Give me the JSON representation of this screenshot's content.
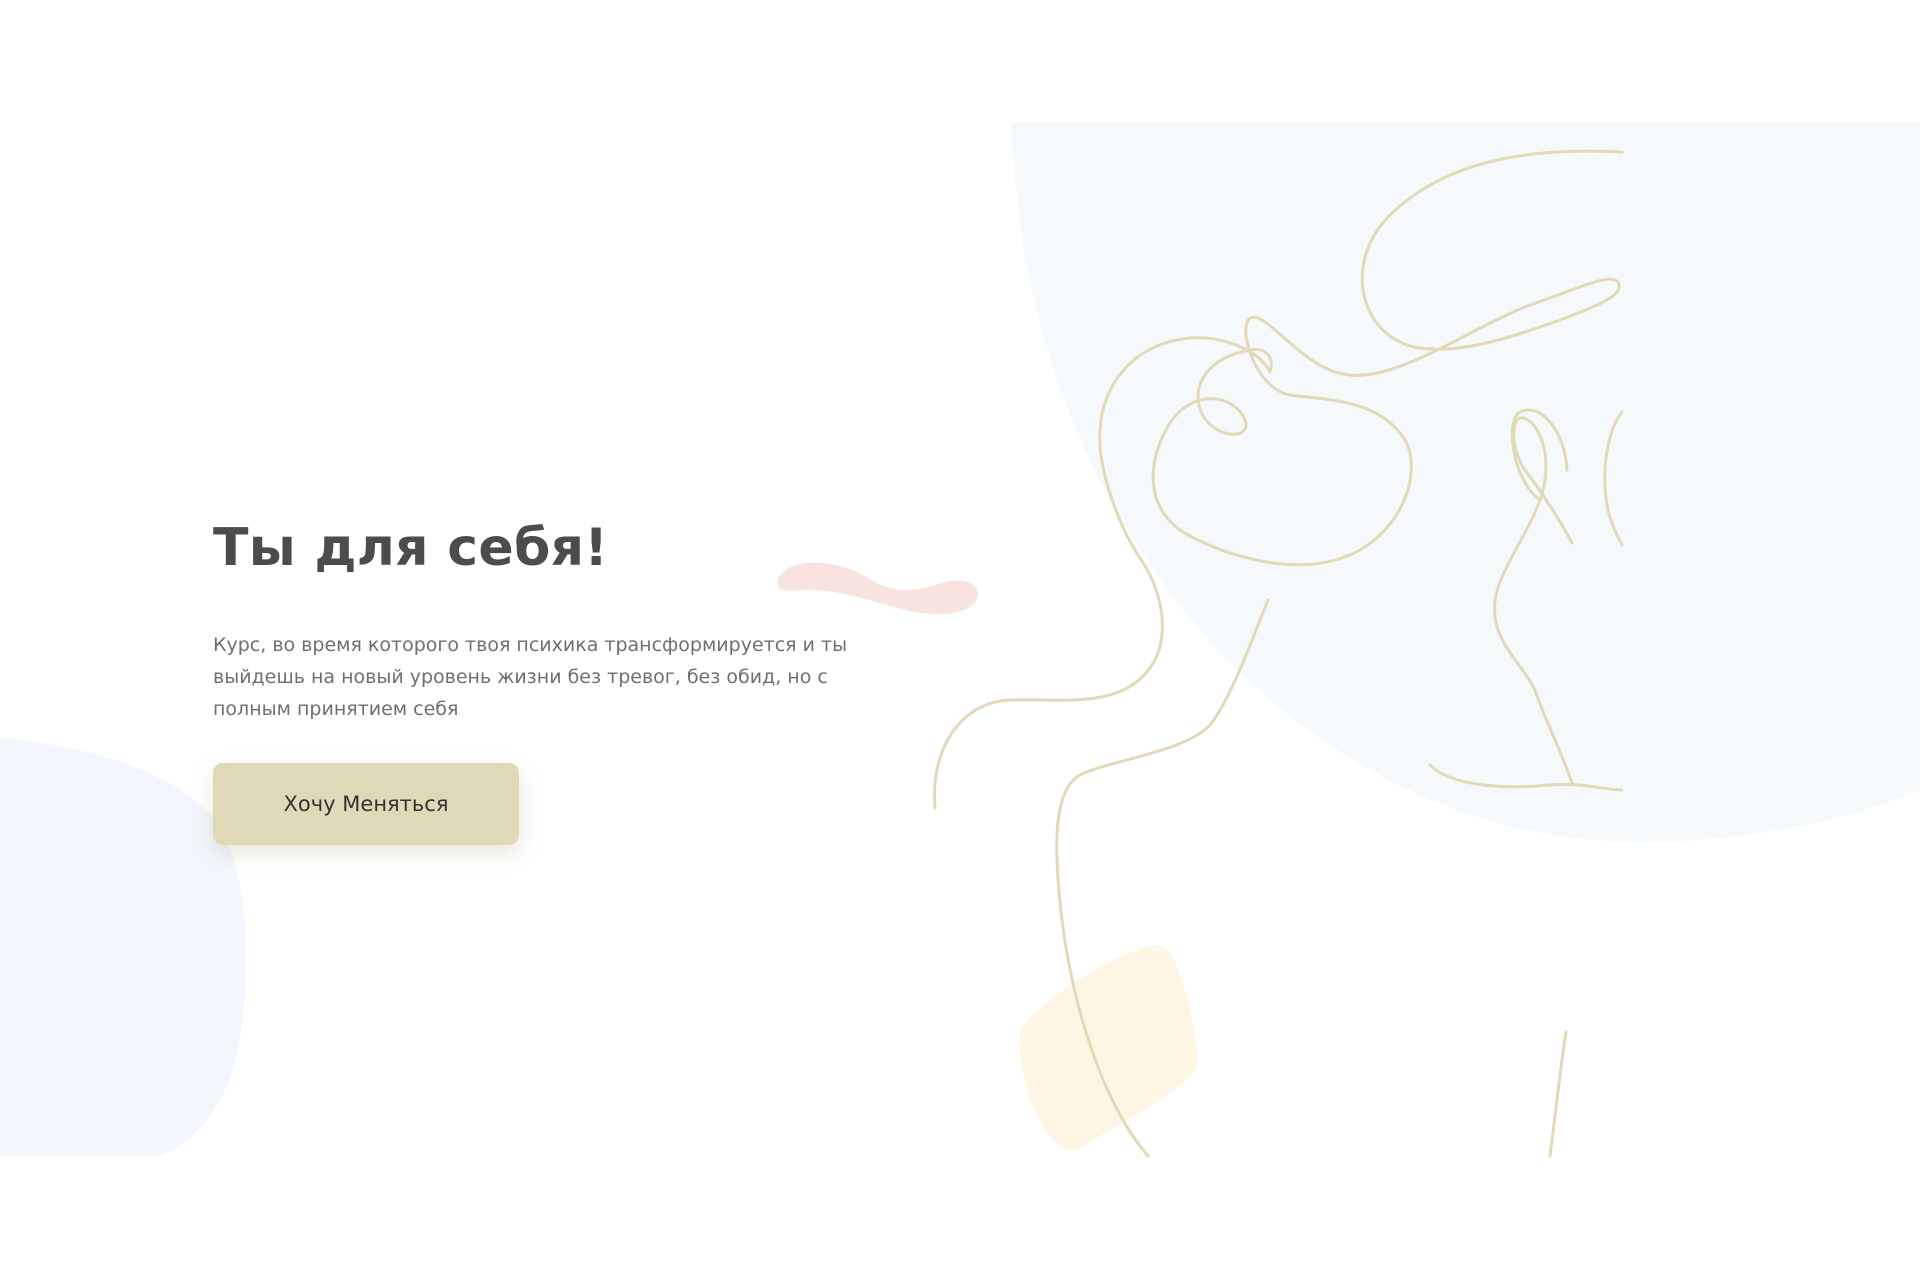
{
  "hero": {
    "title": "Ты для себя!",
    "description": "Курс, во время которого твоя психика трансформируется и ты выйдешь на новый уровень жизни без тревог, без обид, но с полным принятием себя",
    "cta_label": "Хочу Меняться"
  },
  "colors": {
    "background": "#ffffff",
    "title": "#4d4b4b",
    "text": "#6f6f6f",
    "button": "#e0d9b8",
    "line_art": "#e2d9b8",
    "blob_blue": "#f6f9fc",
    "blob_left": "#f3f6fd",
    "blob_pink": "#f9e3df",
    "blob_peach": "#fef5e5"
  }
}
